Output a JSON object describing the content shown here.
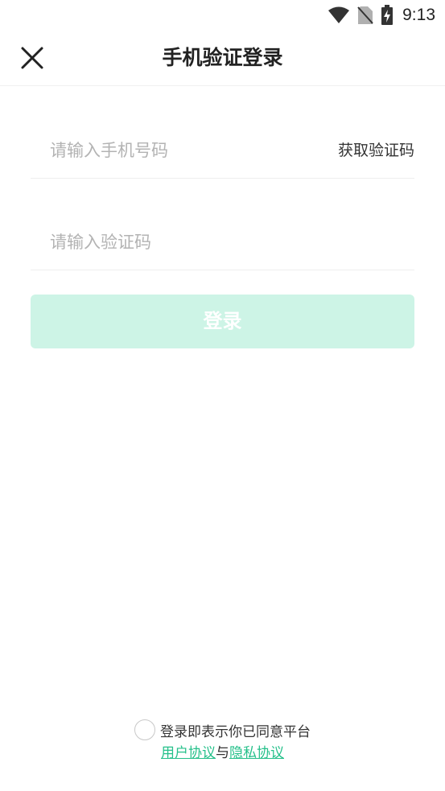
{
  "status_bar": {
    "time": "9:13",
    "icons": [
      "wifi-icon",
      "no-sim-icon",
      "battery-charging-icon"
    ]
  },
  "header": {
    "title": "手机验证登录",
    "close_icon": "close-icon"
  },
  "form": {
    "phone_placeholder": "请输入手机号码",
    "phone_value": "",
    "get_code_label": "获取验证码",
    "code_placeholder": "请输入验证码",
    "code_value": "",
    "login_label": "登录"
  },
  "agreement": {
    "checked": false,
    "text": "登录即表示你已同意平台",
    "user_agreement": "用户协议",
    "conjunction": "与",
    "privacy_agreement": "隐私协议"
  },
  "colors": {
    "accent": "#25c08a",
    "login_button_disabled": "#cdf4e6",
    "placeholder": "#b3b3b3"
  }
}
